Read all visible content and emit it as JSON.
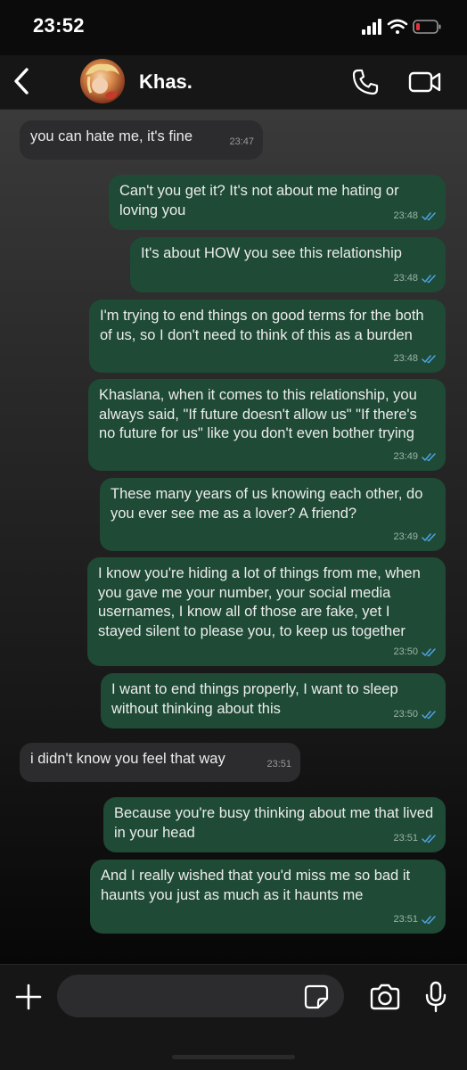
{
  "status_bar": {
    "time": "23:52",
    "icons": [
      "signal-icon",
      "wifi-icon",
      "battery-low-icon"
    ]
  },
  "header": {
    "contact_name": "Khas.",
    "icons": [
      "back-chevron-icon",
      "avatar",
      "phone-icon",
      "video-camera-icon"
    ]
  },
  "colors": {
    "incoming_bubble": "#2c2c2e",
    "outgoing_bubble": "#1e4a36",
    "read_ticks": "#4fa3e8",
    "battery_low": "#e0353a"
  },
  "messages": [
    {
      "direction": "in",
      "text": "you can hate me, it's fine",
      "time": "23:47"
    },
    {
      "direction": "out",
      "text": "Can't you get it? It's not about me hating or loving you",
      "time": "23:48",
      "read": true
    },
    {
      "direction": "out",
      "text": "It's about HOW you see this relationship",
      "time": "23:48",
      "read": true
    },
    {
      "direction": "out",
      "text": "I'm trying to end things on good terms for the both of us, so I don't need to think of this as a burden",
      "time": "23:48",
      "read": true
    },
    {
      "direction": "out",
      "text": "Khaslana, when it comes to this relationship, you always said, \"If future doesn't allow us\" \"If there's no future for us\" like you don't even bother trying",
      "time": "23:49",
      "read": true
    },
    {
      "direction": "out",
      "text": "These many years of us knowing each other, do you ever see me as a lover? A friend?",
      "time": "23:49",
      "read": true
    },
    {
      "direction": "out",
      "text": "I know you're hiding a lot of things from me, when you gave me your number, your social media usernames, I know all of those are fake, yet I stayed silent to please you, to keep us together",
      "time": "23:50",
      "read": true
    },
    {
      "direction": "out",
      "text": "I want to end things properly, I want to sleep without thinking about this",
      "time": "23:50",
      "read": true
    },
    {
      "direction": "in",
      "text": "i didn't know you feel that way",
      "time": "23:51"
    },
    {
      "direction": "out",
      "text": "Because you're busy thinking about me that lived in your head",
      "time": "23:51",
      "read": true
    },
    {
      "direction": "out",
      "text": "And I really wished that you'd miss me so bad it haunts you just as much as it haunts me",
      "time": "23:51",
      "read": true
    }
  ],
  "input_bar": {
    "placeholder": "",
    "icons": [
      "plus-icon",
      "sticker-icon",
      "camera-icon",
      "microphone-icon"
    ]
  }
}
